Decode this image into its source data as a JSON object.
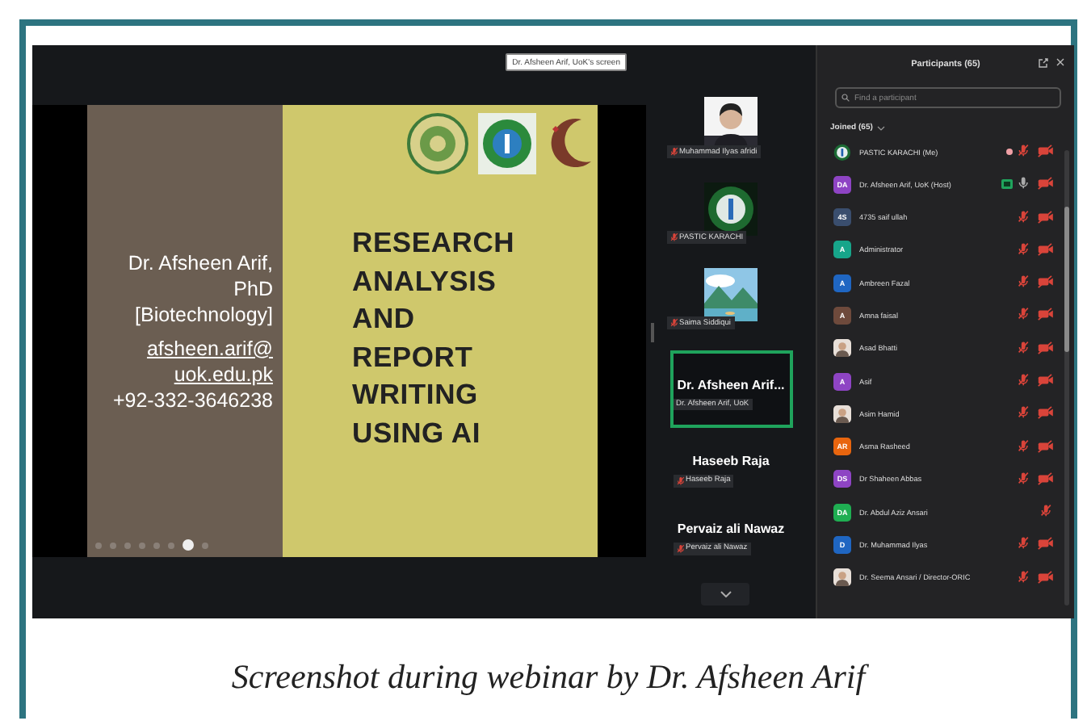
{
  "share_label": "Dr. Afsheen Arif, UoK's screen",
  "slide": {
    "presenter_lines": [
      "Dr. Afsheen Arif,",
      "PhD",
      "[Biotechnology]"
    ],
    "email_lines": [
      "afsheen.arif@",
      "uok.edu.pk"
    ],
    "phone": "+92-332-3646238",
    "title_lines": [
      "RESEARCH",
      "ANALYSIS",
      "AND",
      "REPORT",
      "WRITING",
      "USING AI"
    ]
  },
  "filmstrip": [
    {
      "kind": "person",
      "label": "Muhammad Ilyas afridi",
      "mic_muted": true,
      "selected": false
    },
    {
      "kind": "emblem",
      "label": "PASTIC KARACHI",
      "mic_muted": true,
      "selected": false
    },
    {
      "kind": "landscape",
      "label": "Saima Siddiqui",
      "mic_muted": true,
      "selected": false
    },
    {
      "kind": "name",
      "name": "Dr. Afsheen Arif...",
      "label": "Dr. Afsheen Arif, UoK",
      "mic_muted": false,
      "selected": true
    },
    {
      "kind": "name",
      "name": "Haseeb Raja",
      "label": "Haseeb Raja",
      "mic_muted": true,
      "selected": false
    },
    {
      "kind": "name",
      "name": "Pervaiz ali Nawaz",
      "label": "Pervaiz ali Nawaz",
      "mic_muted": true,
      "selected": false
    }
  ],
  "participants": {
    "title": "Participants (65)",
    "search": {
      "placeholder": "Find a participant"
    },
    "group": "Joined (65)",
    "items": [
      {
        "name": "PASTIC KARACHI (Me)",
        "avatar": {
          "kind": "emblem"
        },
        "status_dot": true,
        "sharing": false,
        "mic_muted": true,
        "video_off": true
      },
      {
        "name": "Dr. Afsheen Arif, UoK (Host)",
        "avatar": {
          "kind": "initials",
          "text": "DA",
          "color": "#8e44c4"
        },
        "status_dot": false,
        "sharing": true,
        "mic_muted": false,
        "video_off": true
      },
      {
        "name": "4735 saif ullah",
        "avatar": {
          "kind": "initials",
          "text": "4S",
          "color": "#3a4e6e"
        },
        "status_dot": false,
        "sharing": false,
        "mic_muted": true,
        "video_off": true
      },
      {
        "name": "Administrator",
        "avatar": {
          "kind": "initials",
          "text": "A",
          "color": "#17a58a"
        },
        "status_dot": false,
        "sharing": false,
        "mic_muted": true,
        "video_off": true
      },
      {
        "name": "Ambreen Fazal",
        "avatar": {
          "kind": "initials",
          "text": "A",
          "color": "#1f66c2"
        },
        "status_dot": false,
        "sharing": false,
        "mic_muted": true,
        "video_off": true
      },
      {
        "name": "Amna faisal",
        "avatar": {
          "kind": "initials",
          "text": "A",
          "color": "#6e4a3c"
        },
        "status_dot": false,
        "sharing": false,
        "mic_muted": true,
        "video_off": true
      },
      {
        "name": "Asad Bhatti",
        "status_dot": false,
        "sharing": false,
        "mic_muted": true,
        "video_off": true
      },
      {
        "name": "Asif",
        "avatar": {
          "kind": "initials",
          "text": "A",
          "color": "#8e44c4"
        },
        "status_dot": false,
        "sharing": false,
        "mic_muted": true,
        "video_off": true
      },
      {
        "name": "Asim Hamid",
        "status_dot": false,
        "sharing": false,
        "mic_muted": true,
        "video_off": true
      },
      {
        "name": "Asma Rasheed",
        "avatar": {
          "kind": "initials",
          "text": "AR",
          "color": "#e8650e"
        },
        "status_dot": false,
        "sharing": false,
        "mic_muted": true,
        "video_off": true
      },
      {
        "name": "Dr Shaheen Abbas",
        "avatar": {
          "kind": "initials",
          "text": "DS",
          "color": "#8e44c4"
        },
        "status_dot": false,
        "sharing": false,
        "mic_muted": true,
        "video_off": true
      },
      {
        "name": "Dr. Abdul Aziz Ansari",
        "avatar": {
          "kind": "initials",
          "text": "DA",
          "color": "#1fae52"
        },
        "status_dot": false,
        "sharing": false,
        "mic_muted": true,
        "video_off": false
      },
      {
        "name": "Dr. Muhammad Ilyas",
        "avatar": {
          "kind": "initials",
          "text": "D",
          "color": "#1f66c2"
        },
        "status_dot": false,
        "sharing": false,
        "mic_muted": true,
        "video_off": true
      },
      {
        "name": "Dr. Seema Ansari / Director-ORIC",
        "status_dot": false,
        "sharing": false,
        "mic_muted": true,
        "video_off": true
      }
    ]
  },
  "caption": "Screenshot during webinar by Dr. Afsheen Arif"
}
